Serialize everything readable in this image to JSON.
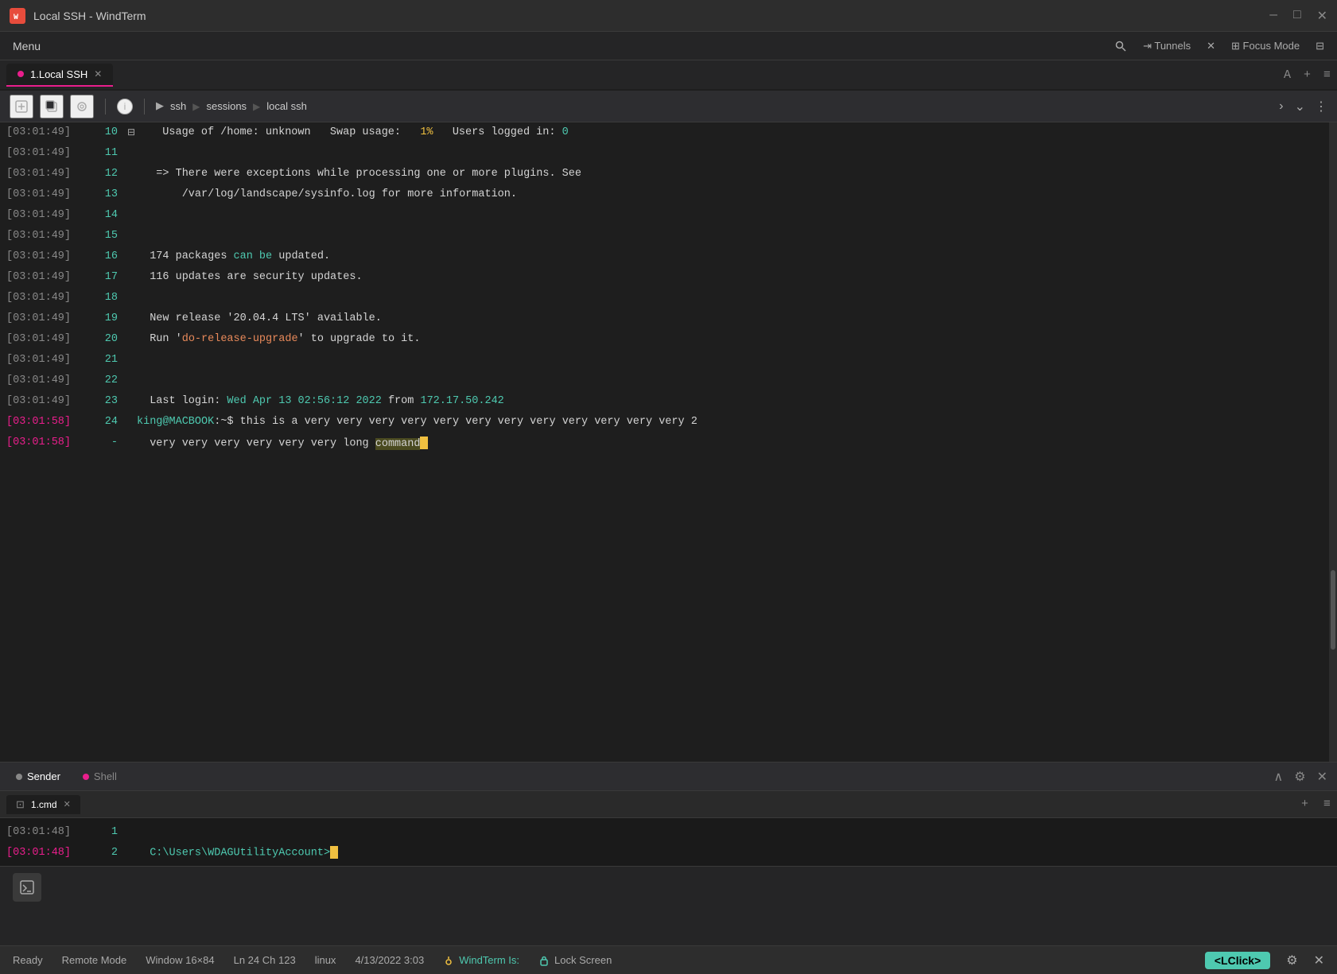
{
  "titleBar": {
    "appName": "Local SSH - WindTerm",
    "appIconText": "W",
    "windowControls": {
      "minimize": "—",
      "maximize": "□",
      "close": "✕"
    }
  },
  "menuBar": {
    "menuItems": [
      "Menu"
    ],
    "rightItems": [
      "🔍",
      "⇥ Tunnels",
      "✕",
      "⊞ Focus Mode",
      "⊟"
    ]
  },
  "tabBar": {
    "tabs": [
      {
        "id": "tab1",
        "label": "1.Local SSH",
        "active": true,
        "dot": true
      }
    ],
    "rightControls": [
      "A",
      "+",
      "≡"
    ]
  },
  "toolbar": {
    "breadcrumb": [
      "ssh",
      "sessions",
      "local ssh"
    ],
    "rightControls": [
      ">",
      "≡"
    ]
  },
  "terminal": {
    "lines": [
      {
        "time": "[03:01:49]",
        "timeActive": false,
        "num": "10",
        "collapse": true,
        "content": "  Usage of /home: unknown   Swap usage:   ",
        "highlight": "1%",
        "suffix": "   Users logged in: ",
        "suffix2": "0"
      },
      {
        "time": "[03:01:49]",
        "timeActive": false,
        "num": "11",
        "content": ""
      },
      {
        "time": "[03:01:49]",
        "timeActive": false,
        "num": "12",
        "content": "   => There were exceptions while processing one or more plugins. See"
      },
      {
        "time": "[03:01:49]",
        "timeActive": false,
        "num": "13",
        "content": "       /var/log/landscape/sysinfo.log for more information."
      },
      {
        "time": "[03:01:49]",
        "timeActive": false,
        "num": "14",
        "content": ""
      },
      {
        "time": "[03:01:49]",
        "timeActive": false,
        "num": "15",
        "content": ""
      },
      {
        "time": "[03:01:49]",
        "timeActive": false,
        "num": "16",
        "content": "  174 packages ",
        "canBe": "can be",
        "suffix": " updated."
      },
      {
        "time": "[03:01:49]",
        "timeActive": false,
        "num": "17",
        "content": "  116 updates are security updates."
      },
      {
        "time": "[03:01:49]",
        "timeActive": false,
        "num": "18",
        "content": ""
      },
      {
        "time": "[03:01:49]",
        "timeActive": false,
        "num": "19",
        "content": "  New release '20.04.4 LTS' available."
      },
      {
        "time": "[03:01:49]",
        "timeActive": false,
        "num": "20",
        "content": "  Run '",
        "doRelease": "do-release-upgrade",
        "suffix": "' to upgrade to it."
      },
      {
        "time": "[03:01:49]",
        "timeActive": false,
        "num": "21",
        "content": ""
      },
      {
        "time": "[03:01:49]",
        "timeActive": false,
        "num": "22",
        "content": ""
      },
      {
        "time": "[03:01:49]",
        "timeActive": false,
        "num": "23",
        "content": "  Last login: ",
        "loginDate": "Wed Apr 13 02:56:12 2022",
        "from": " from ",
        "ip": "172.17.50.242"
      },
      {
        "time": "[03:01:58]",
        "timeActive": true,
        "num": "24",
        "content": "  king@MACBOOK:~$ this is a very very very very very very very very very very very very 2"
      },
      {
        "time": "[03:01:58]",
        "timeActive": true,
        "num": "-",
        "content": "  very very very very very very long command",
        "cursor": true
      }
    ]
  },
  "bottomPanel": {
    "tabs": [
      "Sender",
      "Shell"
    ],
    "activeTab": "Sender",
    "fileTab": "1.cmd",
    "lines": [
      {
        "time": "[03:01:48]",
        "timeActive": false,
        "num": "1",
        "content": ""
      },
      {
        "time": "[03:01:48]",
        "timeActive": true,
        "num": "2",
        "content": "  C:\\Users\\WDAGUtilityAccount>",
        "cursor": true
      }
    ]
  },
  "statusBar": {
    "ready": "Ready",
    "remoteMode": "Remote Mode",
    "window": "Window 16×84",
    "position": "Ln 24 Ch 123",
    "os": "linux",
    "date": "4/13/2022 3:03",
    "windterm": "WindTerm Is:",
    "lockScreen": "Lock Screen",
    "lclick": "<LClick>"
  },
  "colors": {
    "accent": "#e91e8c",
    "cyan": "#4ec9b0",
    "yellow": "#f0c040",
    "orange": "#e8895a",
    "pink": "#e91e8c"
  }
}
